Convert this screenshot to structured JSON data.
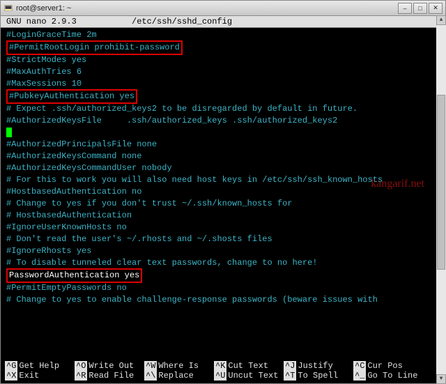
{
  "titlebar": {
    "text": "root@server1: ~"
  },
  "header": {
    "app": "GNU nano 2.9.3",
    "file": "/etc/ssh/sshd_config"
  },
  "lines": {
    "l0": "#LoginGraceTime 2m",
    "l1": "#PermitRootLogin prohibit-password",
    "l2": "#StrictModes yes",
    "l3": "#MaxAuthTries 6",
    "l4": "#MaxSessions 10",
    "l5": "",
    "l6": "#PubkeyAuthentication yes",
    "l7": "",
    "l8": "# Expect .ssh/authorized_keys2 to be disregarded by default in future.",
    "l9": "#AuthorizedKeysFile     .ssh/authorized_keys .ssh/authorized_keys2",
    "l10": "",
    "l11": "#AuthorizedPrincipalsFile none",
    "l12": "",
    "l13": "#AuthorizedKeysCommand none",
    "l14": "#AuthorizedKeysCommandUser nobody",
    "l15": "",
    "l16": "# For this to work you will also need host keys in /etc/ssh/ssh_known_hosts",
    "l17": "#HostbasedAuthentication no",
    "l18": "# Change to yes if you don't trust ~/.ssh/known_hosts for",
    "l19": "# HostbasedAuthentication",
    "l20": "#IgnoreUserKnownHosts no",
    "l21": "# Don't read the user's ~/.rhosts and ~/.shosts files",
    "l22": "#IgnoreRhosts yes",
    "l23": "",
    "l24": "# To disable tunneled clear text passwords, change to no here!",
    "l25": "PasswordAuthentication yes",
    "l26": "#PermitEmptyPasswords no",
    "l27": "",
    "l28": "# Change to yes to enable challenge-response passwords (beware issues with"
  },
  "watermark": "kangarif.net",
  "menu": {
    "k0": "^G",
    "m0": "Get Help",
    "k1": "^O",
    "m1": "Write Out",
    "k2": "^W",
    "m2": "Where Is",
    "k3": "^K",
    "m3": "Cut Text",
    "k4": "^J",
    "m4": "Justify",
    "k5": "^C",
    "m5": "Cur Pos",
    "k6": "^X",
    "m6": "Exit",
    "k7": "^R",
    "m7": "Read File",
    "k8": "^\\",
    "m8": "Replace",
    "k9": "^U",
    "m9": "Uncut Text",
    "k10": "^T",
    "m10": "To Spell",
    "k11": "^_",
    "m11": "Go To Line"
  }
}
